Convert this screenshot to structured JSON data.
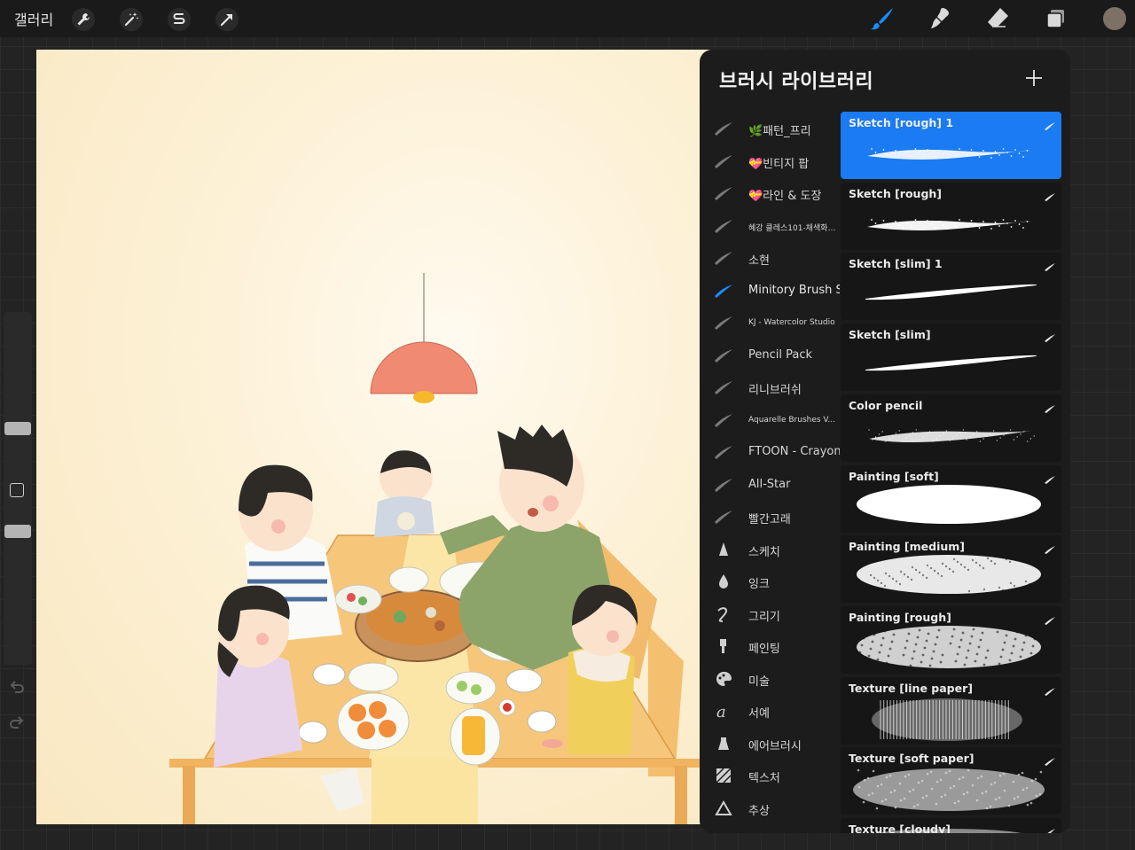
{
  "topbar": {
    "gallery_label": "갤러리",
    "left_tools": [
      {
        "icon": "wrench-icon"
      },
      {
        "icon": "magic-wand-icon"
      },
      {
        "icon": "selection-icon"
      },
      {
        "icon": "transform-arrow-icon"
      }
    ],
    "right_tools": [
      {
        "icon": "brush-icon",
        "active": true
      },
      {
        "icon": "smudge-icon"
      },
      {
        "icon": "eraser-icon"
      },
      {
        "icon": "layers-icon"
      },
      {
        "icon": "color-picker-icon"
      }
    ],
    "active_color": "#1a8cff"
  },
  "colors": {
    "selected_brush_bg": "#1a7bf2",
    "active_tool": "#1a8cff",
    "current_color": "#7d7166"
  },
  "panel": {
    "title": "브러시 라이브러리",
    "brush_sets": [
      {
        "label": "🌿패턴_프리",
        "icon": "stroke-thumb-icon",
        "small": false,
        "active": false
      },
      {
        "label": "💝빈티지 팝",
        "icon": "stroke-thumb-icon",
        "small": false,
        "active": false
      },
      {
        "label": "💝라인 & 도장",
        "icon": "stroke-thumb-icon",
        "small": false,
        "active": false
      },
      {
        "label": "혜강 클레스101-채색화…",
        "icon": "stroke-thumb-icon",
        "small": true,
        "active": false
      },
      {
        "label": "소현",
        "icon": "stroke-thumb-icon",
        "small": false,
        "active": false
      },
      {
        "label": "Minitory Brush Set",
        "icon": "stroke-thumb-icon",
        "small": false,
        "active": true
      },
      {
        "label": "KJ - Watercolor Studio",
        "icon": "stroke-thumb-icon",
        "small": true,
        "active": false
      },
      {
        "label": "Pencil Pack",
        "icon": "stroke-thumb-icon",
        "small": false,
        "active": false
      },
      {
        "label": "리니브러쉬",
        "icon": "stroke-thumb-icon",
        "small": false,
        "active": false
      },
      {
        "label": "Aquarelle Brushes V...",
        "icon": "stroke-thumb-icon",
        "small": true,
        "active": false
      },
      {
        "label": "FTOON - Crayon",
        "icon": "stroke-thumb-icon",
        "small": false,
        "active": false
      },
      {
        "label": "All-Star",
        "icon": "stroke-thumb-icon",
        "small": false,
        "active": false
      },
      {
        "label": "빨간고래",
        "icon": "stroke-thumb-icon",
        "small": false,
        "active": false
      },
      {
        "label": "스케치",
        "icon": "pencil-tip-icon",
        "small": false,
        "active": false
      },
      {
        "label": "잉크",
        "icon": "ink-drop-icon",
        "small": false,
        "active": false
      },
      {
        "label": "그리기",
        "icon": "squiggle-icon",
        "small": false,
        "active": false
      },
      {
        "label": "페인팅",
        "icon": "paint-brush-icon",
        "small": false,
        "active": false
      },
      {
        "label": "미술",
        "icon": "palette-icon",
        "small": false,
        "active": false
      },
      {
        "label": "서예",
        "icon": "calligraphy-icon",
        "small": false,
        "active": false
      },
      {
        "label": "에어브러시",
        "icon": "airbrush-icon",
        "small": false,
        "active": false
      },
      {
        "label": "텍스처",
        "icon": "texture-icon",
        "small": false,
        "active": false
      },
      {
        "label": "추상",
        "icon": "triangle-icon",
        "small": false,
        "active": false
      }
    ],
    "brushes": [
      {
        "name": "Sketch [rough]  1",
        "selected": true,
        "stroke": "rough"
      },
      {
        "name": "Sketch [rough]",
        "selected": false,
        "stroke": "rough"
      },
      {
        "name": "Sketch [slim] 1",
        "selected": false,
        "stroke": "slim"
      },
      {
        "name": "Sketch [slim]",
        "selected": false,
        "stroke": "slim"
      },
      {
        "name": "Color pencil",
        "selected": false,
        "stroke": "pencil"
      },
      {
        "name": "Painting [soft]",
        "selected": false,
        "stroke": "soft"
      },
      {
        "name": "Painting [medium]",
        "selected": false,
        "stroke": "medium"
      },
      {
        "name": "Painting [rough]",
        "selected": false,
        "stroke": "roughpaint"
      },
      {
        "name": "Texture [line paper]",
        "selected": false,
        "stroke": "lines"
      },
      {
        "name": "Texture [soft paper]",
        "selected": false,
        "stroke": "paper"
      },
      {
        "name": "Texture [cloudy]",
        "selected": false,
        "stroke": "cloudy"
      }
    ]
  }
}
